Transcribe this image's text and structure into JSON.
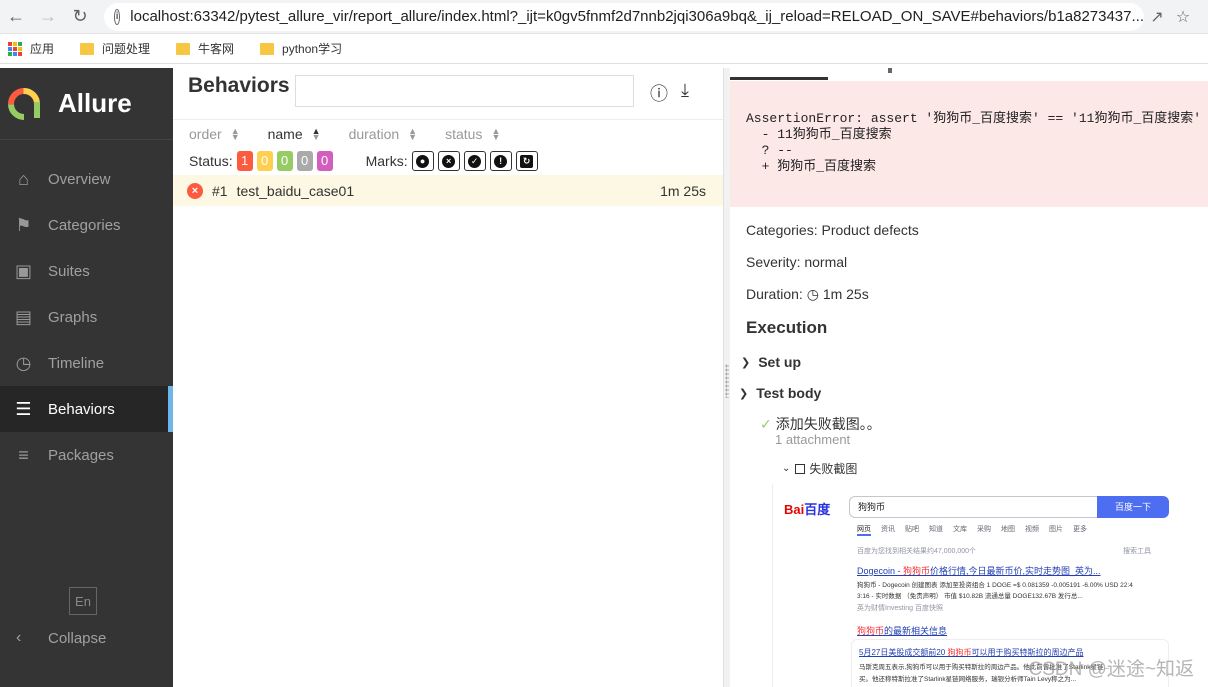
{
  "browser": {
    "url": "localhost:63342/pytest_allure_vir/report_allure/index.html?_ijt=k0gv5fnmf2d7nnb2jqi306a9bq&_ij_reload=RELOAD_ON_SAVE#behaviors/b1a8273437...",
    "bookmarks": [
      {
        "label": "应用",
        "icon": "apps-grid-icon"
      },
      {
        "label": "问题处理",
        "icon": "folder-icon"
      },
      {
        "label": "牛客网",
        "icon": "folder-icon"
      },
      {
        "label": "python学习",
        "icon": "folder-icon"
      }
    ]
  },
  "sidebar": {
    "brand": "Allure",
    "items": [
      {
        "label": "Overview",
        "icon": "home-icon",
        "active": false
      },
      {
        "label": "Categories",
        "icon": "flag-icon",
        "active": false
      },
      {
        "label": "Suites",
        "icon": "briefcase-icon",
        "active": false
      },
      {
        "label": "Graphs",
        "icon": "bar-chart-icon",
        "active": false
      },
      {
        "label": "Timeline",
        "icon": "clock-icon",
        "active": false
      },
      {
        "label": "Behaviors",
        "icon": "list-icon",
        "active": true
      },
      {
        "label": "Packages",
        "icon": "align-left-icon",
        "active": false
      }
    ],
    "language": "En",
    "collapse_label": "Collapse"
  },
  "behaviors": {
    "title": "Behaviors",
    "search_placeholder": "",
    "sort": {
      "order": "order",
      "name": "name",
      "duration": "duration",
      "status": "status"
    },
    "status_label": "Status:",
    "status_counts": [
      {
        "value": "1",
        "color": "#fd5a3e"
      },
      {
        "value": "0",
        "color": "#ffd050"
      },
      {
        "value": "0",
        "color": "#97cc64"
      },
      {
        "value": "0",
        "color": "#aaaaaa"
      },
      {
        "value": "0",
        "color": "#d35ebe"
      }
    ],
    "marks_label": "Marks:",
    "test": {
      "number": "#1",
      "name": "test_baidu_case01",
      "duration": "1m 25s",
      "status": "failed"
    }
  },
  "detail": {
    "error_lines": [
      "AssertionError: assert '狗狗币_百度搜索' == '11狗狗币_百度搜索'",
      "  - 11狗狗币_百度搜索",
      "  ? --",
      "  + 狗狗币_百度搜索"
    ],
    "categories": "Categories: Product defects",
    "severity": "Severity: normal",
    "duration_label": "Duration:",
    "duration_value": "1m 25s",
    "execution_title": "Execution",
    "setup_label": "Set up",
    "test_body_label": "Test body",
    "step_label": "添加失败截图。。",
    "attachment_count": "1 attachment",
    "attachment_name": "失败截图"
  },
  "screenshot": {
    "logo_a": "Bai",
    "logo_b": "百度",
    "query": "狗狗币",
    "button": "百度一下",
    "tabs": [
      "网页",
      "资讯",
      "贴吧",
      "知道",
      "文库",
      "采购",
      "地图",
      "视频",
      "图片",
      "更多"
    ],
    "result_count": "百度为您找到相关结果约47,000,000个",
    "search_tools": "搜索工具",
    "result1_title_a": "Dogecoin - ",
    "result1_title_red": "狗狗币",
    "result1_title_b": "价格行情,今日最新币价,实时走势图_英为...",
    "result1_line1": "狗狗币 - Dogecoin 创建图表 添加至投资组合 1 DOGE =$ 0.081359 -0.005191 -6.00% USD 22:4",
    "result1_line2": "3:16 - 实时数据 （免责声明） 市值 $10.82B 流通总量 DOGE132.67B 发行总...",
    "result1_source": "英为财情Investing    百度快照",
    "related_red": "狗狗币",
    "related_rest": "的最新相关信息",
    "news_title_a": "5月27日美股成交额前20 ",
    "news_title_red": "狗狗币",
    "news_title_b": "可以用于购买特斯拉的周边产品",
    "news_line1": "马斯克周五表示,狗狗币可以用于购买特斯拉的周边产品。他此前曾批准了Starlink星链...",
    "news_line2": "买。他还称特斯拉准了Starlink星链网络服务，瑞银分析师Tain Levy称之为..."
  },
  "watermark": "CSDN @迷途~知返"
}
